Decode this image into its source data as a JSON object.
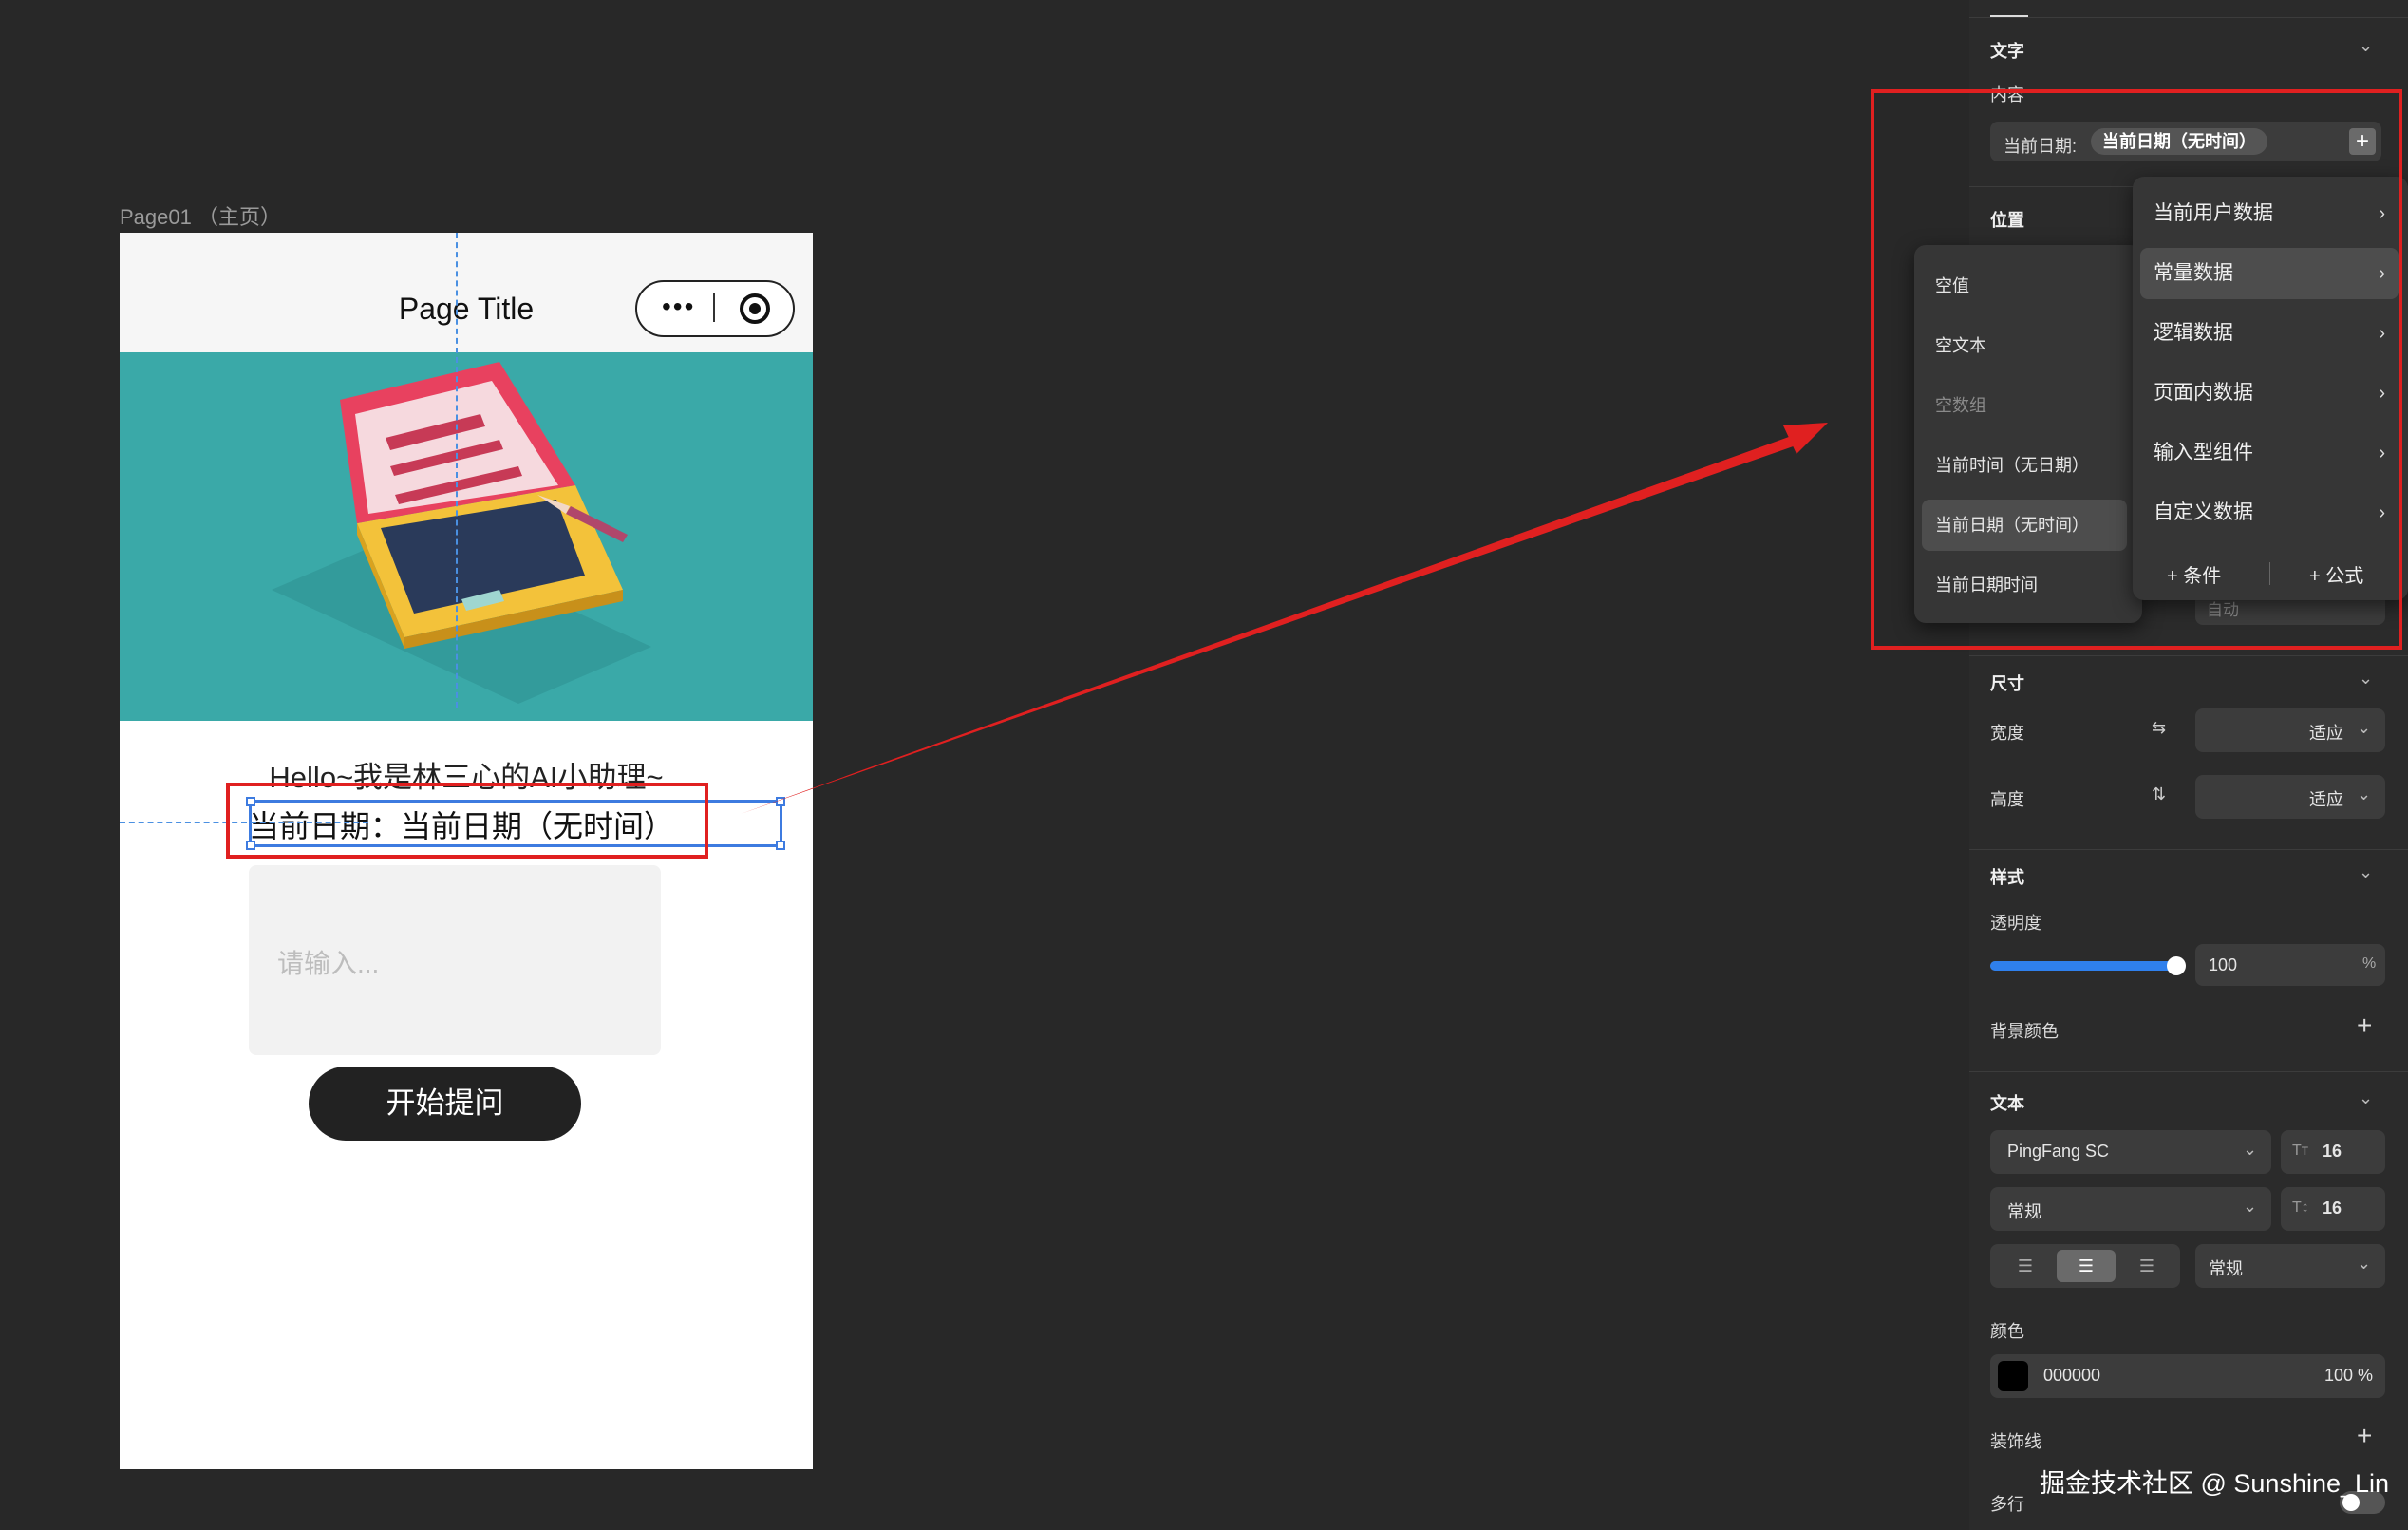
{
  "canvas": {
    "page_label": "Page01 （主页）"
  },
  "phone": {
    "nav_title": "Page Title",
    "capsule_dots": "•••",
    "greeting": "Hello~我是林三心的AI小助理~",
    "date_text": "当前日期：当前日期（无时间）",
    "input_placeholder": "请输入...",
    "ask_button": "开始提问"
  },
  "panel": {
    "text_section": {
      "title": "文字",
      "content_label": "内容",
      "content_prefix": "当前日期:",
      "content_chip": "当前日期（无时间）",
      "add_icon": "plus-icon"
    },
    "position_section": {
      "title": "位置",
      "auto_value": "自动"
    },
    "submenu": {
      "items": [
        {
          "label": "空值",
          "disabled": false,
          "active": false
        },
        {
          "label": "空文本",
          "disabled": false,
          "active": false
        },
        {
          "label": "空数组",
          "disabled": true,
          "active": false
        },
        {
          "label": "当前时间（无日期）",
          "disabled": false,
          "active": false
        },
        {
          "label": "当前日期（无时间）",
          "disabled": false,
          "active": true
        },
        {
          "label": "当前日期时间",
          "disabled": false,
          "active": false
        }
      ]
    },
    "mainmenu": {
      "items": [
        {
          "label": "当前用户数据",
          "active": false
        },
        {
          "label": "常量数据",
          "active": true
        },
        {
          "label": "逻辑数据",
          "active": false
        },
        {
          "label": "页面内数据",
          "active": false
        },
        {
          "label": "输入型组件",
          "active": false
        },
        {
          "label": "自定义数据",
          "active": false
        }
      ],
      "condition_button": "+ 条件",
      "formula_button": "+ 公式"
    },
    "size_section": {
      "title": "尺寸",
      "width_label": "宽度",
      "width_value": "适应",
      "height_label": "高度",
      "height_value": "适应"
    },
    "style_section": {
      "title": "样式",
      "opacity_label": "透明度",
      "opacity_value": "100",
      "opacity_unit": "%",
      "opacity_level": 1.0,
      "bg_color_label": "背景颜色"
    },
    "typography": {
      "title": "文本",
      "font_family": "PingFang SC",
      "font_size": "16",
      "font_weight": "常规",
      "line_height": "16",
      "align_options": [
        "left",
        "center",
        "right"
      ],
      "align_selected": "center",
      "letter_style": "常规",
      "color_label": "颜色",
      "color_hex": "000000",
      "color_opacity": "100 %",
      "swatch_color": "#000000",
      "decoration_label": "装饰线",
      "multiline_label": "多行"
    }
  },
  "accent": {
    "highlight_red": "#e02020",
    "selection_blue": "#3d7be0",
    "slider_blue": "#2f80ed"
  },
  "watermark": "掘金技术社区 @ Sunshine_Lin"
}
